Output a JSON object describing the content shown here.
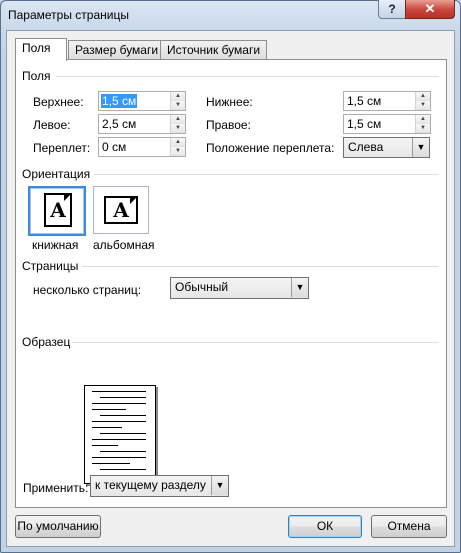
{
  "window": {
    "title": "Параметры страницы",
    "help_label": "?",
    "close_label": "✕"
  },
  "tabs": [
    {
      "label": "Поля",
      "active": true
    },
    {
      "label": "Размер бумаги",
      "active": false
    },
    {
      "label": "Источник бумаги",
      "active": false
    }
  ],
  "margins": {
    "section_label": "Поля",
    "top": {
      "label": "Верхнее:",
      "value": "1,5 см"
    },
    "bottom": {
      "label": "Нижнее:",
      "value": "1,5 см"
    },
    "left": {
      "label": "Левое:",
      "value": "2,5 см"
    },
    "right": {
      "label": "Правое:",
      "value": "1,5 см"
    },
    "gutter": {
      "label": "Переплет:",
      "value": "0 см"
    },
    "gutter_position": {
      "label": "Положение переплета:",
      "value": "Слева"
    }
  },
  "orientation": {
    "section_label": "Ориентация",
    "portrait_label": "книжная",
    "landscape_label": "альбомная",
    "icon_letter": "A"
  },
  "pages": {
    "section_label": "Страницы",
    "multiple_label": "несколько страниц:",
    "multiple_value": "Обычный"
  },
  "preview": {
    "section_label": "Образец"
  },
  "apply": {
    "label": "Применить:",
    "value": "к текущему разделу"
  },
  "buttons": {
    "default_label": "По умолчанию",
    "ok_label": "ОК",
    "cancel_label": "Отмена"
  }
}
